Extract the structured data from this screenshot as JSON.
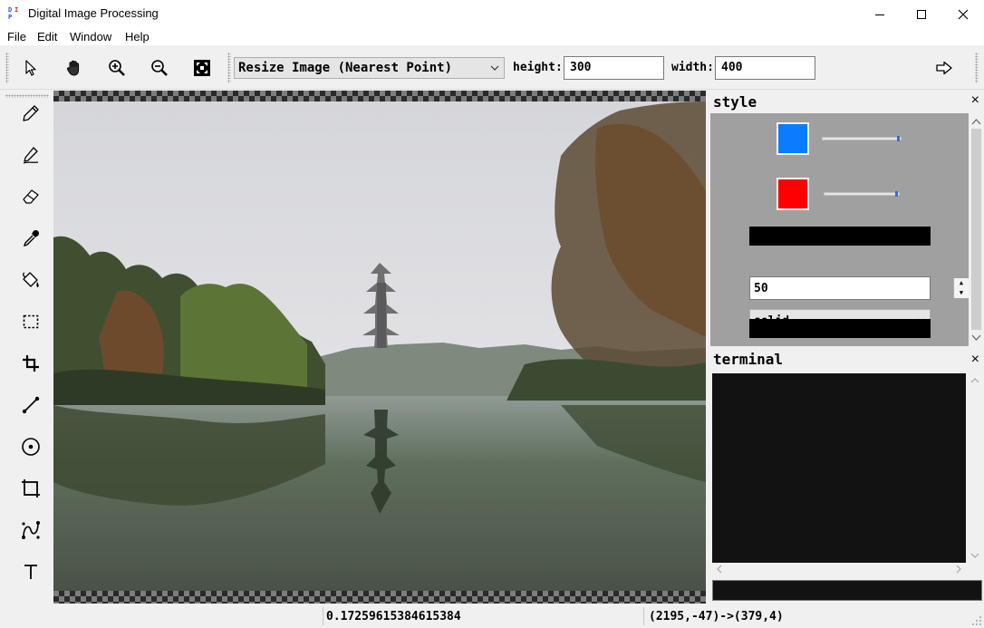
{
  "window": {
    "title": "Digital Image Processing",
    "icon_letters": [
      "D",
      "I",
      "P"
    ],
    "icon_name": "app-icon"
  },
  "menu": [
    "File",
    "Edit",
    "Window",
    "Help"
  ],
  "toolbar": {
    "tools": [
      "pointer-icon",
      "hand-icon",
      "zoom-in-icon",
      "zoom-out-icon",
      "fit-to-window-icon"
    ],
    "mode_value": "Resize Image (Nearest Point)",
    "height_label": "height:",
    "height_value": "300",
    "width_label": "width:",
    "width_value": "400",
    "apply_icon": "arrow-right-icon"
  },
  "palette": [
    "pencil-icon",
    "pen-icon",
    "eraser-icon",
    "eyedropper-icon",
    "fill-bucket-icon",
    "rect-select-icon",
    "crop-icon",
    "line-icon",
    "circle-icon",
    "rectangle-icon",
    "bezier-curve-icon",
    "text-icon"
  ],
  "style_panel": {
    "title": "style",
    "close": "×",
    "primary_color": "#0a7dff",
    "secondary_color": "#ff0000",
    "primary_alpha": 1.0,
    "secondary_alpha": 1.0,
    "line_width": "50",
    "line_style": "solid"
  },
  "terminal_panel": {
    "title": "terminal",
    "close": "×"
  },
  "status": {
    "value": "0.17259615384615384",
    "coords": "(2195,-47)->(379,4)"
  }
}
